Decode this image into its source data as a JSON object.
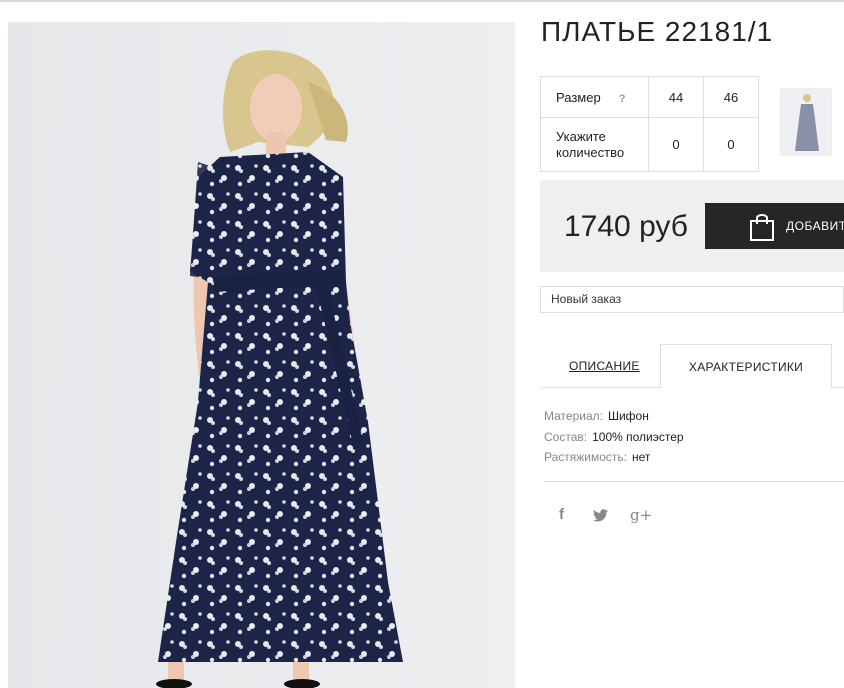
{
  "product": {
    "title": "ПЛАТЬЕ 22181/1",
    "image_alt": "woman-in-floral-maxi-dress"
  },
  "size_table": {
    "size_label": "Размер",
    "help": "?",
    "sizes": [
      "44",
      "46"
    ],
    "qty_label": "Укажите количество",
    "quantities": [
      "0",
      "0"
    ]
  },
  "purchase": {
    "price": "1740 руб",
    "add_button": "ДОБАВИТЬ"
  },
  "order_select": {
    "value": "Новый заказ"
  },
  "tabs": [
    {
      "label": "ОПИСАНИЕ",
      "active": false
    },
    {
      "label": "ХАРАКТЕРИСТИКИ",
      "active": true
    }
  ],
  "characteristics": [
    {
      "key": "Материал:",
      "value": "Шифон"
    },
    {
      "key": "Состав:",
      "value": "100% полиэстер"
    },
    {
      "key": "Растяжимость:",
      "value": "нет"
    }
  ],
  "social": {
    "facebook": "f",
    "twitter_icon": "twitter-icon",
    "googleplus": "g+"
  },
  "colors": {
    "dress": "#1c2447",
    "button_bg": "#262626",
    "price_box_bg": "#efefef"
  }
}
